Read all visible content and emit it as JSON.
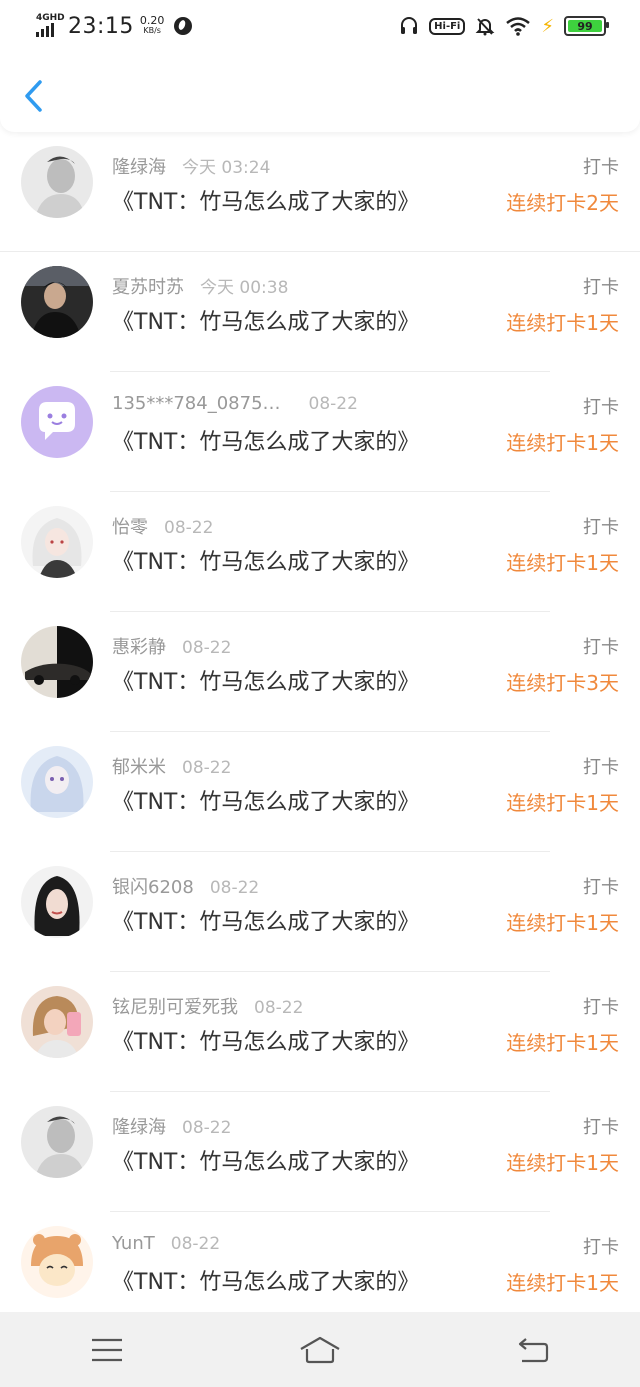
{
  "status_bar": {
    "network": "4GHD",
    "time": "23:15",
    "speed_value": "0.20",
    "speed_unit": "KB/s",
    "hifi": "Hi-Fi",
    "battery_level": "99"
  },
  "header": {
    "back_icon": "chevron-left-icon"
  },
  "entries": [
    {
      "user": "隆绿海",
      "date": "今天 03:24",
      "title": "《TNT：竹马怎么成了大家的》",
      "label": "打卡",
      "streak": "连续打卡2天"
    },
    {
      "user": "夏苏时苏",
      "date": "今天 00:38",
      "title": "《TNT：竹马怎么成了大家的》",
      "label": "打卡",
      "streak": "连续打卡1天"
    },
    {
      "user": "135***784_0875…",
      "date": "08-22",
      "title": "《TNT：竹马怎么成了大家的》",
      "label": "打卡",
      "streak": "连续打卡1天"
    },
    {
      "user": "怡零",
      "date": "08-22",
      "title": "《TNT：竹马怎么成了大家的》",
      "label": "打卡",
      "streak": "连续打卡1天"
    },
    {
      "user": "惠彩静",
      "date": "08-22",
      "title": "《TNT：竹马怎么成了大家的》",
      "label": "打卡",
      "streak": "连续打卡3天"
    },
    {
      "user": "郁米米",
      "date": "08-22",
      "title": "《TNT：竹马怎么成了大家的》",
      "label": "打卡",
      "streak": "连续打卡1天"
    },
    {
      "user": "银闪6208",
      "date": "08-22",
      "title": "《TNT：竹马怎么成了大家的》",
      "label": "打卡",
      "streak": "连续打卡1天"
    },
    {
      "user": "铉尼别可爱死我",
      "date": "08-22",
      "title": "《TNT：竹马怎么成了大家的》",
      "label": "打卡",
      "streak": "连续打卡1天"
    },
    {
      "user": "隆绿海",
      "date": "08-22",
      "title": "《TNT：竹马怎么成了大家的》",
      "label": "打卡",
      "streak": "连续打卡1天"
    },
    {
      "user": "YunT",
      "date": "08-22",
      "title": "《TNT：竹马怎么成了大家的》",
      "label": "打卡",
      "streak": "连续打卡1天"
    }
  ],
  "colors": {
    "accent_blue": "#2f9bf0",
    "streak_orange": "#f0893c",
    "nav_background": "#f1f1f1"
  },
  "nav": {
    "menu_icon": "menu-icon",
    "home_icon": "home-icon",
    "back_icon": "back-arrow-icon"
  }
}
